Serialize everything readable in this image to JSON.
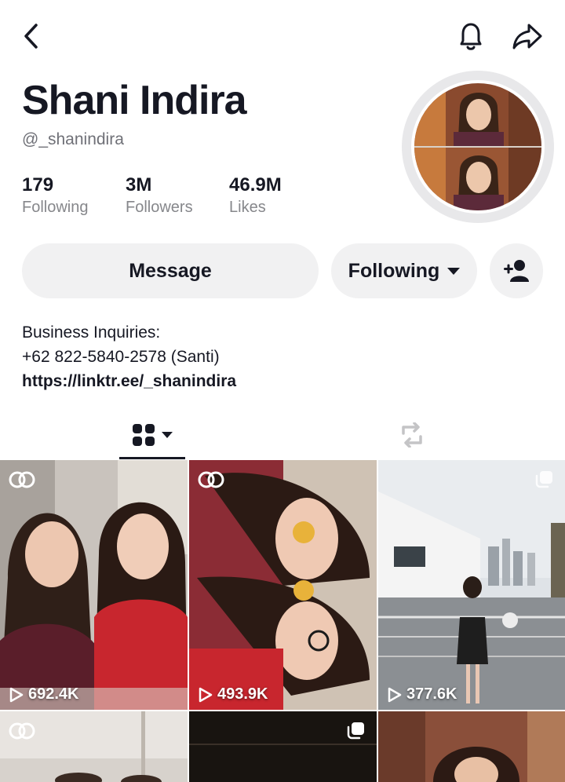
{
  "header": {
    "back_icon": "chevron-left-icon",
    "notification_icon": "bell-icon",
    "share_icon": "share-arrow-icon"
  },
  "profile": {
    "name": "Shani Indira",
    "handle": "@_shanindira",
    "stats": [
      {
        "value": "179",
        "label": "Following"
      },
      {
        "value": "3M",
        "label": "Followers"
      },
      {
        "value": "46.9M",
        "label": "Likes"
      }
    ]
  },
  "actions": {
    "message_label": "Message",
    "following_label": "Following",
    "add_friend_icon": "add-person-icon"
  },
  "bio": {
    "line1": "Business Inquiries:",
    "line2": "+62 822-5840-2578 (Santi)",
    "link": "https://linktr.ee/_shanindira"
  },
  "tabs": [
    {
      "name": "videos",
      "icon": "grid-icon",
      "selected": true
    },
    {
      "name": "reposts",
      "icon": "repost-icon",
      "selected": false
    }
  ],
  "videos": [
    {
      "views": "692.4K",
      "badge": "collab-icon"
    },
    {
      "views": "493.9K",
      "badge": "collab-icon"
    },
    {
      "views": "377.6K",
      "badge": "multi-photo-icon"
    },
    {
      "views": "",
      "badge": "collab-icon"
    },
    {
      "views": "",
      "badge": "multi-photo-icon"
    },
    {
      "views": "",
      "badge": ""
    }
  ],
  "colors": {
    "text_primary": "#161823",
    "text_secondary": "#86878b",
    "button_bg": "#f1f1f2"
  }
}
